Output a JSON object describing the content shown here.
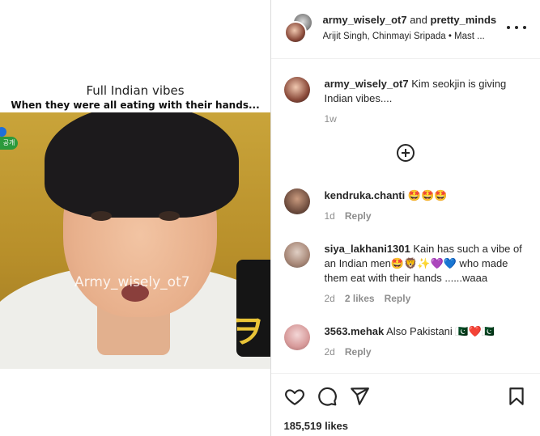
{
  "media": {
    "caption_title": "Full Indian vibes",
    "caption_sub": "When they were all eating with their hands...",
    "watermark": "Army_wisely_ot7",
    "badge_text": "공개",
    "mic_logo": "ヲ"
  },
  "header": {
    "user_primary": "army_wisely_ot7",
    "joiner": " and ",
    "user_secondary": "pretty_minds",
    "audio": "Arijit Singh, Chinmayi Sripada • Mast ..."
  },
  "comments": [
    {
      "username": "army_wisely_ot7",
      "text": "Kim seokjin is giving Indian vibes....",
      "time": "1w",
      "likes": "",
      "reply": ""
    },
    {
      "username": "kendruka.chanti",
      "text": "🤩🤩🤩",
      "time": "1d",
      "likes": "",
      "reply": "Reply"
    },
    {
      "username": "siya_lakhani1301",
      "text": "Kain has such a vibe of an Indian men🤩🦁✨💜💙 who made them eat with their hands ......waaa",
      "time": "2d",
      "likes": "2 likes",
      "reply": "Reply"
    },
    {
      "username": "3563.mehak",
      "text": "Also Pakistani 🇵🇰❤️🇵🇰",
      "time": "2d",
      "likes": "",
      "reply": "Reply"
    }
  ],
  "actions": {
    "like_icon": "heart-icon",
    "comment_icon": "comment-bubble-icon",
    "share_icon": "paper-plane-icon",
    "save_icon": "bookmark-icon",
    "likes_count": "185,519 likes"
  },
  "colors": {
    "text": "#262626",
    "muted": "#8e8e8e",
    "divider": "#efefef"
  }
}
